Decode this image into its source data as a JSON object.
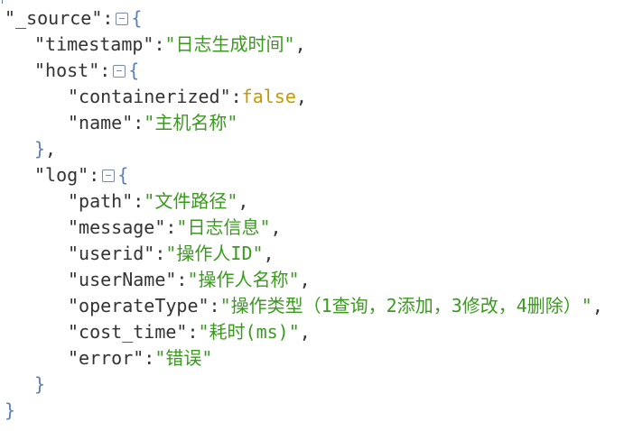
{
  "json": {
    "source_key": "\"_source\"",
    "timestamp_key": "\"timestamp\"",
    "timestamp_val": "\"日志生成时间\"",
    "host_key": "\"host\"",
    "containerized_key": "\"containerized\"",
    "containerized_val": "false",
    "name_key": "\"name\"",
    "name_val": "\"主机名称\"",
    "log_key": "\"log\"",
    "path_key": "\"path\"",
    "path_val": "\"文件路径\"",
    "message_key": "\"message\"",
    "message_val": "\"日志信息\"",
    "userid_key": "\"userid\"",
    "userid_val": "\"操作人ID\"",
    "username_key": "\"userName\"",
    "username_val": "\"操作人名称\"",
    "operatetype_key": "\"operateType\"",
    "operatetype_val": "\"操作类型（1查询，2添加，3修改，4删除）\"",
    "costtime_key": "\"cost_time\"",
    "costtime_val": "\"耗时(ms)\"",
    "error_key": "\"error\"",
    "error_val": "\"错误\""
  },
  "icons": {
    "collapse": "collapse-toggle-icon"
  },
  "colors": {
    "string": "#3a9a1e",
    "boolean": "#c49a00",
    "brace": "#5b7fb5",
    "key": "#333333"
  }
}
